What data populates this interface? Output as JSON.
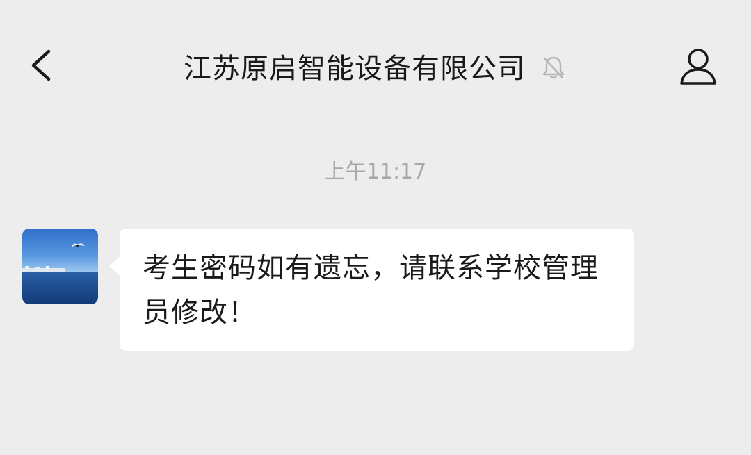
{
  "header": {
    "title": "江苏原启智能设备有限公司",
    "back_icon": "chevron-left-icon",
    "mute_icon": "bell-off-icon",
    "profile_icon": "person-icon"
  },
  "chat": {
    "timestamp": "上午11:17",
    "messages": [
      {
        "sender": "incoming",
        "avatar": "seascape-avatar",
        "text": "考生密码如有遗忘，请联系学校管理员修改！"
      }
    ]
  },
  "colors": {
    "background": "#ededed",
    "bubble": "#ffffff",
    "title_text": "#191919",
    "timestamp_text": "#a8a8a8"
  }
}
